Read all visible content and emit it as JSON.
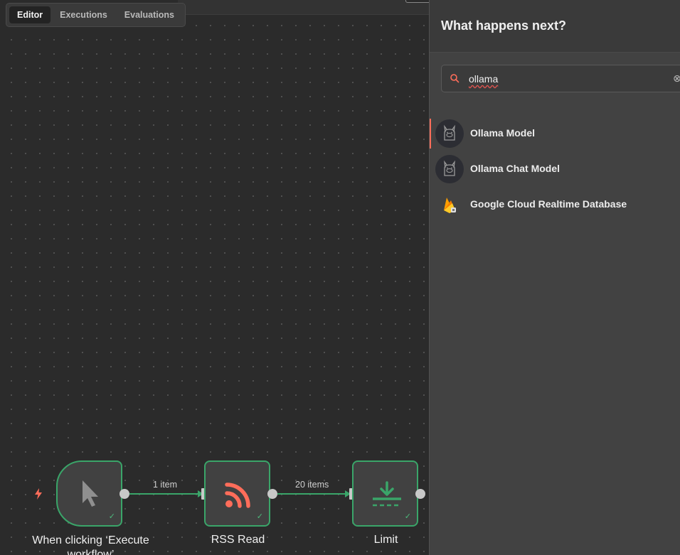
{
  "tabs": [
    {
      "label": "Editor",
      "active": true
    },
    {
      "label": "Executions",
      "active": false
    },
    {
      "label": "Evaluations",
      "active": false
    }
  ],
  "nodes": {
    "trigger": {
      "label": "When clicking ‘Execute workflow’",
      "icon": "cursor-icon",
      "status": "success"
    },
    "rss": {
      "label": "RSS Read",
      "icon": "rss-icon",
      "status": "success"
    },
    "limit": {
      "label": "Limit",
      "icon": "limit-icon",
      "status": "success"
    }
  },
  "edges": [
    {
      "from": "trigger",
      "to": "rss",
      "label": "1 item"
    },
    {
      "from": "rss",
      "to": "limit",
      "label": "20 items"
    }
  ],
  "panel": {
    "title": "What happens next?",
    "search": {
      "value": "ollama",
      "icon": "search-icon"
    },
    "results": [
      {
        "label": "Ollama Model",
        "icon": "ollama-icon",
        "active": true
      },
      {
        "label": "Ollama Chat Model",
        "icon": "ollama-icon",
        "active": false
      },
      {
        "label": "Google Cloud Realtime Database",
        "icon": "firebase-icon",
        "active": false
      }
    ]
  },
  "colors": {
    "success": "#3aa569",
    "accent": "#ff6d5a",
    "canvas": "#2b2b2b",
    "panel": "#424242"
  }
}
